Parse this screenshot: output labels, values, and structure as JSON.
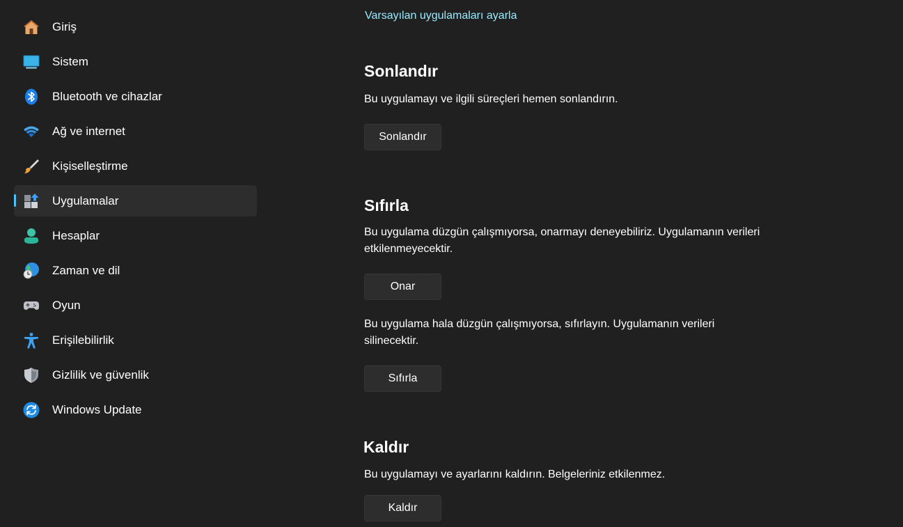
{
  "sidebar": {
    "items": [
      {
        "label": "Giriş",
        "icon": "home-icon",
        "selected": false
      },
      {
        "label": "Sistem",
        "icon": "monitor-icon",
        "selected": false
      },
      {
        "label": "Bluetooth ve cihazlar",
        "icon": "bluetooth-icon",
        "selected": false
      },
      {
        "label": "Ağ ve internet",
        "icon": "wifi-icon",
        "selected": false
      },
      {
        "label": "Kişiselleştirme",
        "icon": "paintbrush-icon",
        "selected": false
      },
      {
        "label": "Uygulamalar",
        "icon": "apps-icon",
        "selected": true
      },
      {
        "label": "Hesaplar",
        "icon": "person-icon",
        "selected": false
      },
      {
        "label": "Zaman ve dil",
        "icon": "globe-clock-icon",
        "selected": false
      },
      {
        "label": "Oyun",
        "icon": "gamepad-icon",
        "selected": false
      },
      {
        "label": "Erişilebilirlik",
        "icon": "accessibility-icon",
        "selected": false
      },
      {
        "label": "Gizlilik ve güvenlik",
        "icon": "shield-icon",
        "selected": false
      },
      {
        "label": "Windows Update",
        "icon": "update-icon",
        "selected": false
      }
    ],
    "accent_color": "#4cc2ff"
  },
  "main": {
    "default_apps_link": "Varsayılan uygulamaları ayarla",
    "terminate": {
      "title": "Sonlandır",
      "description": "Bu uygulamayı ve ilgili süreçleri hemen sonlandırın.",
      "button": "Sonlandır"
    },
    "reset": {
      "title": "Sıfırla",
      "repair_description": "Bu uygulama düzgün çalışmıyorsa, onarmayı deneyebiliriz. Uygulamanın verileri etkilenmeyecektir.",
      "repair_button": "Onar",
      "reset_description": "Bu uygulama hala düzgün çalışmıyorsa, sıfırlayın. Uygulamanın verileri silinecektir.",
      "reset_button": "Sıfırla"
    },
    "uninstall": {
      "title": "Kaldır",
      "description": "Bu uygulamayı ve ayarlarını kaldırın. Belgeleriniz etkilenmez.",
      "button": "Kaldır"
    }
  },
  "colors": {
    "background": "#202020",
    "link": "#99ebff",
    "button_bg": "#2d2d2d"
  }
}
